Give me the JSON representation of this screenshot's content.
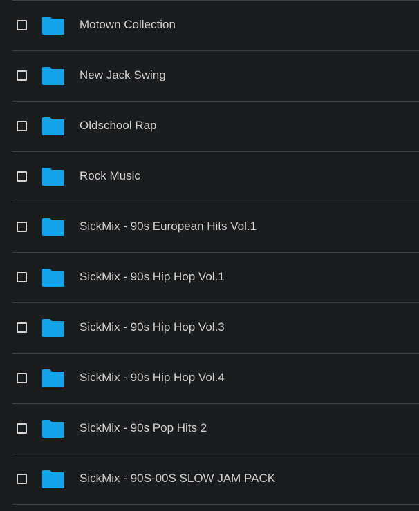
{
  "colors": {
    "background": "#1b1c1e",
    "separator": "#3d3e40",
    "folder": "#12a3e8",
    "text": "#cfcfcf",
    "checkbox": "#d6d6d6"
  },
  "rows": [
    {
      "label": "Motown Collection",
      "icon": "folder-icon",
      "checked": false
    },
    {
      "label": "New Jack Swing",
      "icon": "folder-icon",
      "checked": false
    },
    {
      "label": "Oldschool Rap",
      "icon": "folder-icon",
      "checked": false
    },
    {
      "label": "Rock Music",
      "icon": "folder-icon",
      "checked": false
    },
    {
      "label": "SickMix - 90s European Hits Vol.1",
      "icon": "folder-icon",
      "checked": false
    },
    {
      "label": "SickMix - 90s Hip Hop Vol.1",
      "icon": "folder-icon",
      "checked": false
    },
    {
      "label": "SickMix - 90s Hip Hop Vol.3",
      "icon": "folder-icon",
      "checked": false
    },
    {
      "label": "SickMix - 90s Hip Hop Vol.4",
      "icon": "folder-icon",
      "checked": false
    },
    {
      "label": "SickMix - 90s Pop Hits 2",
      "icon": "folder-icon",
      "checked": false
    },
    {
      "label": "SickMix - 90S-00S SLOW JAM PACK",
      "icon": "folder-icon",
      "checked": false
    }
  ]
}
